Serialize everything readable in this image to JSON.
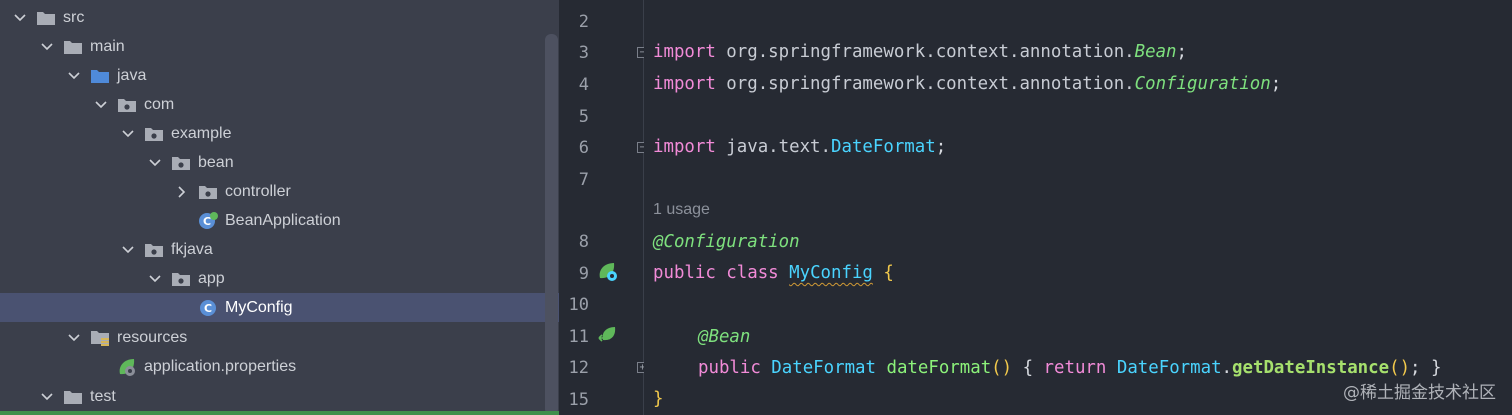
{
  "tree": {
    "items": [
      {
        "label": "src",
        "icon": "folder-icon",
        "expanded": true
      },
      {
        "label": "main",
        "icon": "folder-icon",
        "expanded": true
      },
      {
        "label": "java",
        "icon": "source-folder-icon",
        "expanded": true
      },
      {
        "label": "com",
        "icon": "package-icon",
        "expanded": true
      },
      {
        "label": "example",
        "icon": "package-icon",
        "expanded": true
      },
      {
        "label": "bean",
        "icon": "package-icon",
        "expanded": true
      },
      {
        "label": "controller",
        "icon": "package-icon",
        "expanded": false
      },
      {
        "label": "BeanApplication",
        "icon": "spring-boot-class-icon"
      },
      {
        "label": "fkjava",
        "icon": "package-icon",
        "expanded": true
      },
      {
        "label": "app",
        "icon": "package-icon",
        "expanded": true
      },
      {
        "label": "MyConfig",
        "icon": "class-icon",
        "selected": true
      },
      {
        "label": "resources",
        "icon": "resources-folder-icon",
        "expanded": true
      },
      {
        "label": "application.properties",
        "icon": "spring-properties-icon"
      },
      {
        "label": "test",
        "icon": "folder-icon",
        "expanded": true
      }
    ]
  },
  "editor": {
    "line_numbers": [
      "2",
      "3",
      "4",
      "5",
      "6",
      "7",
      "8",
      "9",
      "10",
      "11",
      "12",
      "15"
    ],
    "usage_hint": "1 usage",
    "lines": {
      "l3": {
        "kw": "import",
        "pkg": " org.springframework.context.annotation.",
        "cls": "Bean",
        "end": ";"
      },
      "l4": {
        "kw": "import",
        "pkg": " org.springframework.context.annotation.",
        "cls": "Configuration",
        "end": ";"
      },
      "l6": {
        "kw": "import",
        "pkg": " java.text.",
        "cls": "DateFormat",
        "end": ";"
      },
      "l8": {
        "ann": "@Configuration"
      },
      "l9": {
        "kw1": "public",
        "kw2": " class ",
        "cls": "MyConfig",
        "brace": " {"
      },
      "l11": {
        "ann": "@Bean"
      },
      "l12": {
        "kw1": "public",
        "type": " DateFormat ",
        "meth": "dateFormat",
        "parens": "()",
        "open": " { ",
        "ret": "return",
        "cls": " DateFormat",
        "dot": ".",
        "call": "getDateInstance",
        "parens2": "()",
        "semi": ";",
        "close": " }"
      },
      "l15": {
        "brace": "}"
      }
    }
  },
  "watermark": "@稀土掘金技术社区",
  "colors": {
    "tree_bg": "#3b3f4b",
    "editor_bg": "#262a33",
    "selection": "#4a5271",
    "keyword": "#f28bd8",
    "class": "#4ad4ff",
    "annotation": "#7ee07e"
  }
}
